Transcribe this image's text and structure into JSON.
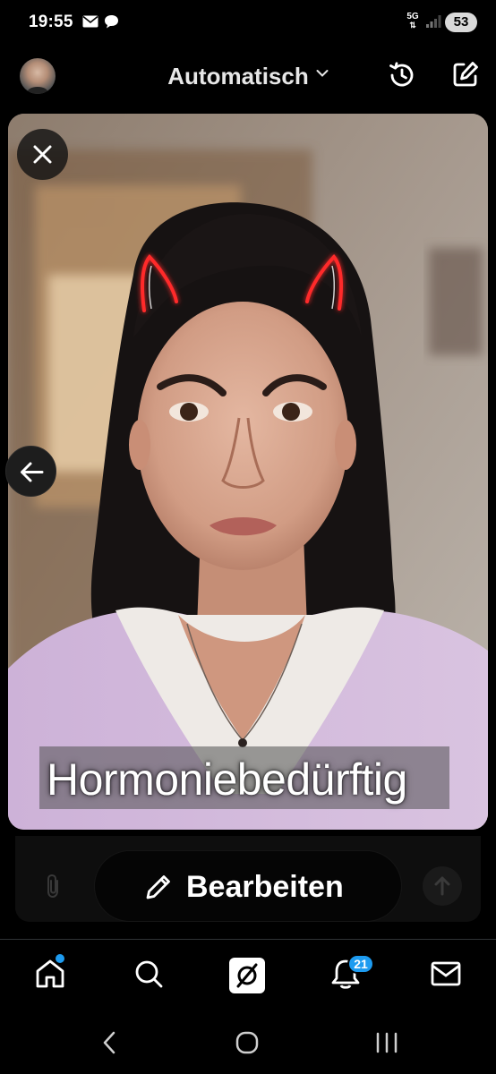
{
  "status_bar": {
    "time": "19:55",
    "network": "5G",
    "battery": "53",
    "icons": [
      "mail-icon",
      "chat-icon",
      "signal-icon"
    ]
  },
  "header": {
    "mode_label": "Automatisch",
    "icons": [
      "history-icon",
      "compose-icon"
    ]
  },
  "image": {
    "caption": "Hormoniebedürftig",
    "close_icon": "close-icon"
  },
  "composer": {
    "edit_label": "Bearbeiten",
    "icons": [
      "pencil-icon",
      "attach-icon",
      "send-icon"
    ]
  },
  "bottom_nav": {
    "items": [
      "home-icon",
      "search-icon",
      "grok-icon",
      "notifications-icon",
      "messages-icon"
    ],
    "notification_count": "21"
  },
  "system_nav": [
    "back",
    "home",
    "recents"
  ],
  "colors": {
    "accent": "#1d9bf0",
    "background": "#000000",
    "horns": "#ff2a2a"
  }
}
